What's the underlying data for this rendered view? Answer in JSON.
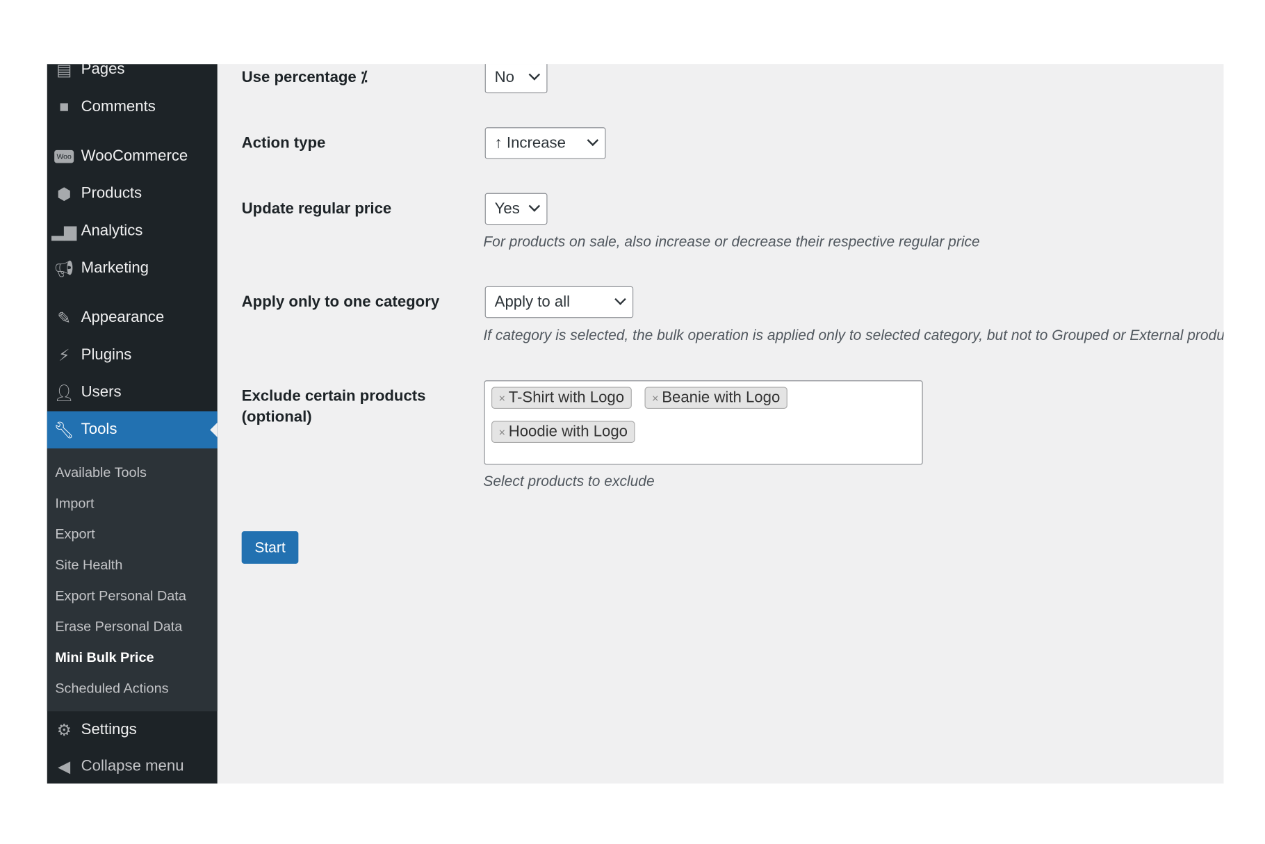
{
  "sidebar": {
    "items": [
      {
        "label": "Pages",
        "icon": "pages-icon"
      },
      {
        "label": "Comments",
        "icon": "comments-icon"
      },
      {
        "label": "WooCommerce",
        "icon": "woocommerce-icon"
      },
      {
        "label": "Products",
        "icon": "products-icon"
      },
      {
        "label": "Analytics",
        "icon": "analytics-icon"
      },
      {
        "label": "Marketing",
        "icon": "marketing-icon"
      },
      {
        "label": "Appearance",
        "icon": "appearance-icon"
      },
      {
        "label": "Plugins",
        "icon": "plugins-icon"
      },
      {
        "label": "Users",
        "icon": "users-icon"
      },
      {
        "label": "Tools",
        "icon": "tools-icon"
      },
      {
        "label": "Settings",
        "icon": "settings-icon"
      },
      {
        "label": "Collapse menu",
        "icon": "collapse-icon"
      }
    ],
    "submenu": [
      "Available Tools",
      "Import",
      "Export",
      "Site Health",
      "Export Personal Data",
      "Erase Personal Data",
      "Mini Bulk Price",
      "Scheduled Actions"
    ],
    "active_item": "Tools",
    "current_submenu": "Mini Bulk Price"
  },
  "form": {
    "use_percentage": {
      "label": "Use percentage ⁒",
      "value": "No"
    },
    "action_type": {
      "label": "Action type",
      "value": "↑ Increase"
    },
    "update_regular": {
      "label": "Update regular price",
      "value": "Yes",
      "description": "For products on sale, also increase or decrease their respective regular price"
    },
    "category": {
      "label": "Apply only to one category",
      "value": "Apply to all",
      "description": "If category is selected, the bulk operation is applied only to selected category, but not to Grouped or External products"
    },
    "exclude": {
      "label": "Exclude certain products (optional)",
      "tags": [
        "T-Shirt with Logo",
        "Beanie with Logo",
        "Hoodie with Logo"
      ],
      "remove_glyph": "×",
      "description": "Select products to exclude"
    },
    "start_label": "Start"
  },
  "colors": {
    "sidebar": "#1d2327",
    "submenu": "#2c3338",
    "accent": "#2271b1",
    "content_bg": "#f0f0f1"
  }
}
